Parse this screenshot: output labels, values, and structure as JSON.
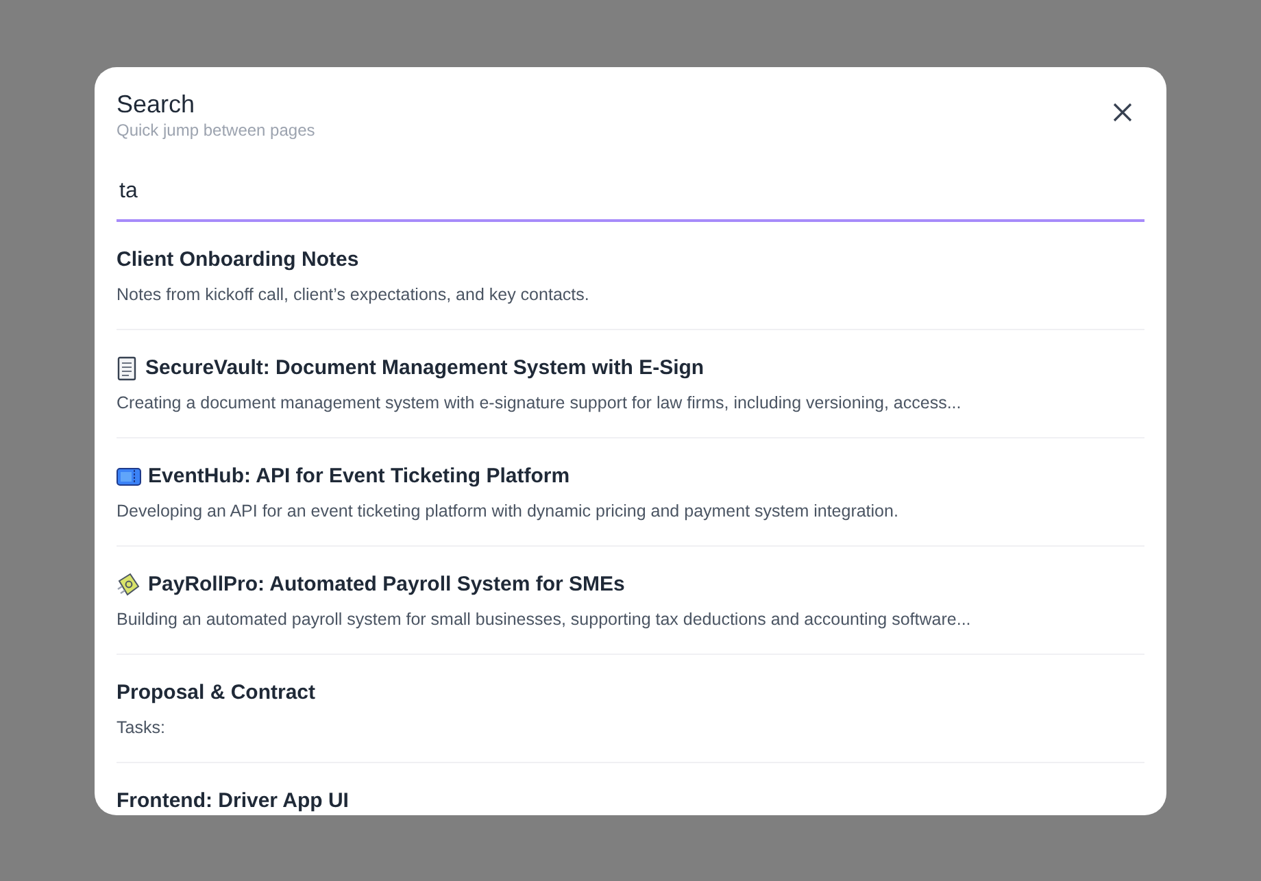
{
  "dialog": {
    "title": "Search",
    "subtitle": "Quick jump between pages"
  },
  "search": {
    "value": "ta"
  },
  "results": [
    {
      "kind": "plain",
      "title": "Client Onboarding Notes",
      "description": "Notes from kickoff call, client’s expectations, and key contacts."
    },
    {
      "kind": "document",
      "title": "SecureVault: Document Management System with E-Sign",
      "description": "Creating a document management system with e-signature support for law firms, including versioning, access..."
    },
    {
      "kind": "ticket",
      "title": "EventHub: API for Event Ticketing Platform",
      "description": "Developing an API for an event ticketing platform with dynamic pricing and payment system integration."
    },
    {
      "kind": "money",
      "title": "PayRollPro: Automated Payroll System for SMEs",
      "description": "Building an automated payroll system for small businesses, supporting tax deductions and accounting software..."
    },
    {
      "kind": "plain",
      "title": "Proposal & Contract",
      "description": "Tasks:"
    },
    {
      "kind": "plain",
      "title": "Frontend: Driver App UI"
    }
  ]
}
